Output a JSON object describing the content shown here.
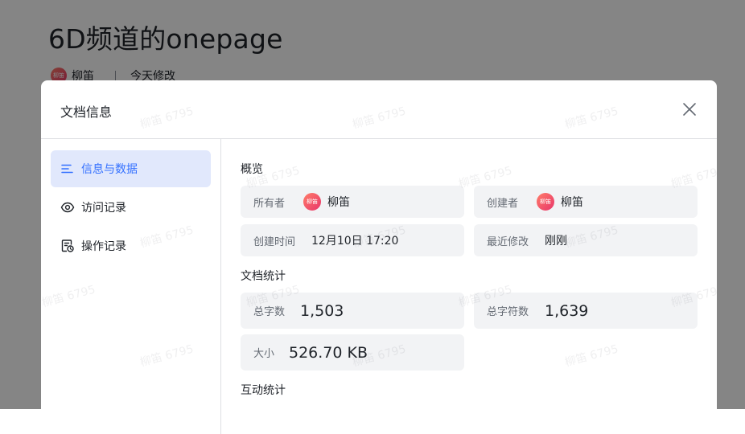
{
  "document": {
    "title": "6D频道的onepage",
    "owner_name": "柳笛",
    "owner_avatar_text": "柳笛",
    "modified": "今天修改"
  },
  "modal": {
    "title": "文档信息",
    "nav": [
      {
        "label": "信息与数据",
        "icon": "list-icon",
        "active": true
      },
      {
        "label": "访问记录",
        "icon": "eye-icon",
        "active": false
      },
      {
        "label": "操作记录",
        "icon": "doc-clock-icon",
        "active": false
      }
    ],
    "overview": {
      "title": "概览",
      "owner_label": "所有者",
      "owner_value": "柳笛",
      "creator_label": "创建者",
      "creator_value": "柳笛",
      "avatar_text": "柳笛",
      "created_label": "创建时间",
      "created_value": "12月10日 17:20",
      "modified_label": "最近修改",
      "modified_value": "刚刚"
    },
    "stats": {
      "title": "文档统计",
      "words_label": "总字数",
      "words_value": "1,503",
      "chars_label": "总字符数",
      "chars_value": "1,639",
      "size_label": "大小",
      "size_value": "526.70 KB"
    },
    "interaction": {
      "title": "互动统计"
    }
  },
  "watermark_text": "柳笛 6795",
  "colors": {
    "accent": "#3370ff",
    "active_bg": "#e1e8fc",
    "card_bg": "#f2f3f5",
    "avatar_gradient": [
      "#ff7d6a",
      "#e8356a"
    ]
  }
}
